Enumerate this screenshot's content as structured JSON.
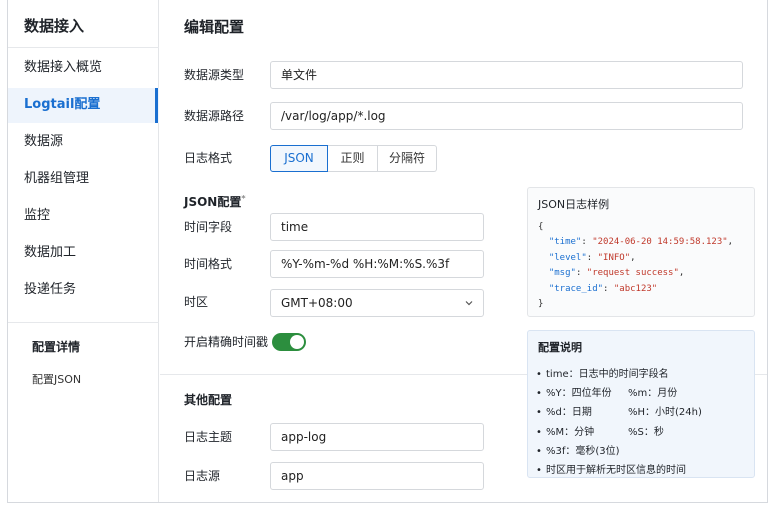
{
  "sidebar": {
    "title": "数据接入",
    "items": [
      {
        "label": "数据接入概览"
      },
      {
        "label": "Logtail配置"
      },
      {
        "label": "数据源"
      },
      {
        "label": "机器组管理"
      },
      {
        "label": "监控"
      },
      {
        "label": "数据加工"
      },
      {
        "label": "投递任务"
      }
    ],
    "section_title": "配置详情",
    "section_item": "配置JSON"
  },
  "main": {
    "title": "编辑配置",
    "source_type": {
      "label": "数据源类型",
      "value": "单文件"
    },
    "source_path": {
      "label": "数据源路径",
      "value": "/var/log/app/*.log"
    },
    "log_format": {
      "label": "日志格式",
      "options": [
        "JSON",
        "正则",
        "分隔符"
      ],
      "selected": "JSON"
    },
    "json_section": {
      "title": "JSON配置",
      "marker": "*"
    },
    "time_field": {
      "label": "时间字段",
      "value": "time"
    },
    "time_format": {
      "label": "时间格式",
      "value": "%Y-%m-%d %H:%M:%S.%3f"
    },
    "timezone": {
      "label": "时区",
      "value": "GMT+08:00"
    },
    "precise_time": {
      "label": "开启精确时间戳",
      "enabled": true
    },
    "other_section": {
      "title": "其他配置"
    },
    "log_topic": {
      "label": "日志主题",
      "value": "app-log"
    },
    "log_source": {
      "label": "日志源",
      "value": "app"
    }
  },
  "sample_panel": {
    "title": "JSON日志样例",
    "open_brace": "{",
    "close_brace": "}",
    "lines": [
      {
        "key": "\"time\"",
        "val": "\"2024-06-20 14:59:58.123\"",
        "end": ","
      },
      {
        "key": "\"level\"",
        "val": "\"INFO\"",
        "end": ","
      },
      {
        "key": "\"msg\"",
        "val": "\"request success\"",
        "end": ","
      },
      {
        "key": "\"trace_id\"",
        "val": "\"abc123\"",
        "end": ""
      }
    ]
  },
  "explain_panel": {
    "title": "配置说明",
    "items": [
      {
        "a": "time：日志中的时间字段名",
        "b": ""
      },
      {
        "a": "%Y：四位年份",
        "b": "%m：月份"
      },
      {
        "a": "%d：日期",
        "b": "%H：小时(24h)"
      },
      {
        "a": "%M：分钟",
        "b": "%S：秒"
      },
      {
        "a": "%3f：毫秒(3位)",
        "b": ""
      },
      {
        "a": "时区用于解析无时区信息的时间",
        "b": ""
      }
    ]
  },
  "colors": {
    "accent": "#1a6fd0",
    "toggle_on": "#2c8e3e"
  }
}
